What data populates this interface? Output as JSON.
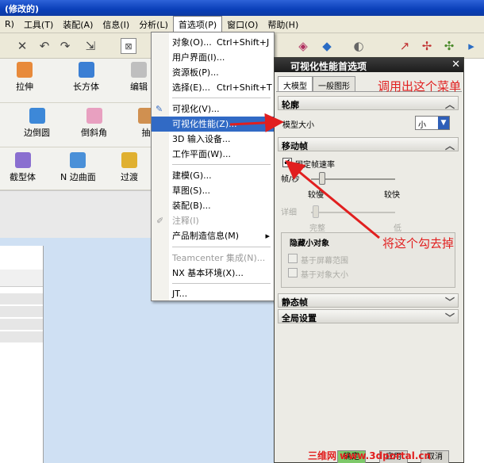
{
  "window": {
    "title": "(修改的)"
  },
  "menubar": {
    "items": [
      {
        "label": "R)"
      },
      {
        "label": "工具(T)"
      },
      {
        "label": "装配(A)"
      },
      {
        "label": "信息(I)"
      },
      {
        "label": "分析(L)"
      },
      {
        "label": "首选项(P)"
      },
      {
        "label": "窗口(O)"
      },
      {
        "label": "帮助(H)"
      }
    ]
  },
  "ribbon": {
    "row1": [
      {
        "label": "拉伸"
      },
      {
        "label": "长方体"
      },
      {
        "label": "编辑"
      }
    ],
    "row2": [
      {
        "label": "边倒圆"
      },
      {
        "label": "倒斜角"
      },
      {
        "label": "抽"
      }
    ],
    "row3": [
      {
        "label": "截型体"
      },
      {
        "label": "N 边曲面"
      },
      {
        "label": "过渡"
      }
    ]
  },
  "dropdown": {
    "items": [
      {
        "label": "对象(O)...",
        "shortcut": "Ctrl+Shift+J"
      },
      {
        "label": "用户界面(I)..."
      },
      {
        "label": "资源板(P)..."
      },
      {
        "label": "选择(E)...",
        "shortcut": "Ctrl+Shift+T"
      },
      {
        "label": "可视化(V)..."
      },
      {
        "label": "可视化性能(Z)..."
      },
      {
        "label": "3D 输入设备..."
      },
      {
        "label": "工作平面(W)..."
      },
      {
        "label": "建模(G)..."
      },
      {
        "label": "草图(S)..."
      },
      {
        "label": "装配(B)..."
      },
      {
        "label": "注释(I)"
      },
      {
        "label": "产品制造信息(M)"
      },
      {
        "label": "Teamcenter 集成(N)..."
      },
      {
        "label": "NX 基本环境(X)..."
      },
      {
        "label": "JT..."
      }
    ]
  },
  "dialog": {
    "title": "可视化性能首选项",
    "close": "✕",
    "tabs": [
      "大模型",
      "一般图形"
    ],
    "sections": {
      "outline": "轮廓",
      "motion": "移动帧",
      "static": "静态帧",
      "global": "全局设置"
    },
    "model_size_label": "模型大小",
    "model_size_value": "小",
    "fixed_rate_label": "固定帧速率",
    "fps_label": "帧/秒",
    "slow_label": "较慢",
    "fast_label": "较快",
    "detail_label": "详细",
    "complete_label": "完整",
    "low_label": "低",
    "hide_small_label": "隐藏小对象",
    "screen_range_label": "基于屏幕范围",
    "object_size_label": "基于对象大小",
    "buttons": [
      "确定",
      "应用",
      "取消"
    ]
  },
  "annotations": {
    "call_menu": "调用出这个菜单",
    "uncheck": "将这个勾去掉"
  },
  "watermark": "三维网 www.3dportal.cn",
  "colors": {
    "annotation_red": "#e11f1f",
    "menu_highlight": "#316ac5"
  }
}
